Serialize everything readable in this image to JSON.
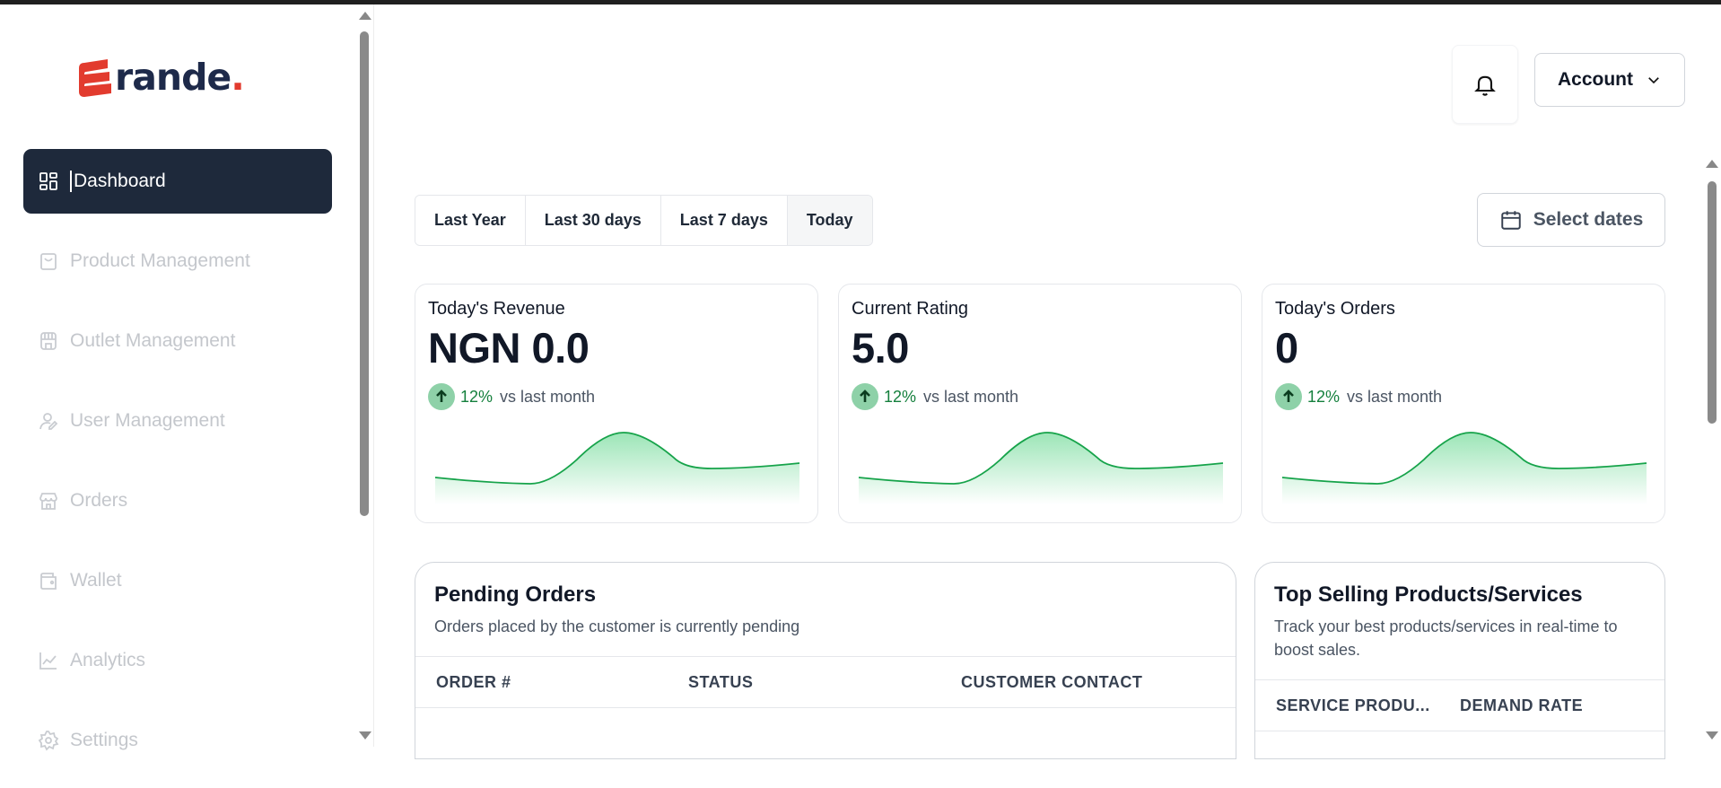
{
  "app": {
    "name": "Grande",
    "logo_text": "rande",
    "logo_dot": "."
  },
  "sidebar": {
    "items": [
      {
        "label": "Dashboard",
        "icon": "dashboard-grid-icon",
        "active": true
      },
      {
        "label": "Product Management",
        "icon": "shopping-bag-icon",
        "active": false
      },
      {
        "label": "Outlet Management",
        "icon": "outlet-icon",
        "active": false
      },
      {
        "label": "User Management",
        "icon": "user-edit-icon",
        "active": false
      },
      {
        "label": "Orders",
        "icon": "store-icon",
        "active": false
      },
      {
        "label": "Wallet",
        "icon": "wallet-icon",
        "active": false
      },
      {
        "label": "Analytics",
        "icon": "chart-line-icon",
        "active": false
      },
      {
        "label": "Settings",
        "icon": "gear-icon",
        "active": false
      }
    ]
  },
  "header": {
    "account_label": "Account",
    "bell_icon": "bell-icon",
    "chevron_icon": "chevron-down-icon"
  },
  "filters": {
    "ranges": [
      "Last Year",
      "Last 30 days",
      "Last 7 days",
      "Today"
    ],
    "selected": "Today",
    "select_dates_label": "Select dates"
  },
  "cards": [
    {
      "title": "Today's Revenue",
      "value": "NGN 0.0",
      "trend_pct": "12%",
      "trend_note": "vs last month"
    },
    {
      "title": "Current Rating",
      "value": "5.0",
      "trend_pct": "12%",
      "trend_note": "vs last month"
    },
    {
      "title": "Today's Orders",
      "value": "0",
      "trend_pct": "12%",
      "trend_note": "vs last month"
    }
  ],
  "pending_orders": {
    "title": "Pending Orders",
    "subtitle": "Orders placed by the customer is currently pending",
    "columns": [
      "ORDER #",
      "STATUS",
      "CUSTOMER CONTACT"
    ]
  },
  "top_selling": {
    "title": "Top Selling Products/Services",
    "subtitle": "Track your best products/services in real-time to boost sales.",
    "columns": [
      "SERVICE PRODU...",
      "DEMAND RATE"
    ]
  },
  "colors": {
    "accent": "#1e293b",
    "positive": "#15803d",
    "brand_red": "#e23b2e",
    "brand_navy": "#1e2a4a",
    "spark_line": "#16a34a"
  }
}
